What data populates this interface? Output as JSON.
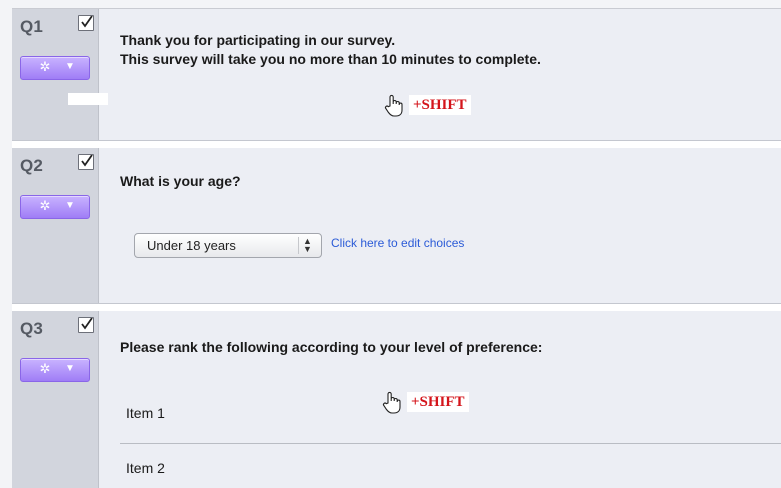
{
  "questions": [
    {
      "id": "Q1",
      "checked": true,
      "text_lines": [
        "Thank you for participating in our survey.",
        "This survey will take you no more than 10 minutes to complete."
      ],
      "cursor_hint": "+SHIFT"
    },
    {
      "id": "Q2",
      "checked": true,
      "text_lines": [
        "What is your age?"
      ],
      "select_value": "Under 18 years",
      "edit_link": "Click here to edit choices"
    },
    {
      "id": "Q3",
      "checked": true,
      "text_lines": [
        "Please rank the following according to your level of preference:"
      ],
      "cursor_hint": "+SHIFT",
      "rank_items": [
        "Item 1",
        "Item 2"
      ]
    }
  ],
  "icons": {
    "gear_button": "gear-icon",
    "dropdown": "chevron-down-icon",
    "cursor": "hand-pointer-icon",
    "checkbox": "checkbox-checked-icon"
  },
  "colors": {
    "gear_button": "#a98af8",
    "shift_text": "#d4141b",
    "link": "#2b5bd7",
    "sidebar": "#d2d5dd",
    "panel": "#eceef4"
  }
}
